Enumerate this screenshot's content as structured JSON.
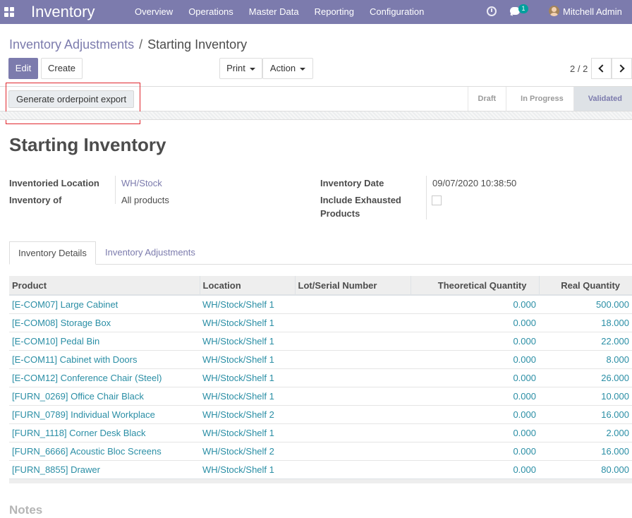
{
  "navbar": {
    "brand": "Inventory",
    "menu": [
      "Overview",
      "Operations",
      "Master Data",
      "Reporting",
      "Configuration"
    ],
    "chat_badge": "1",
    "user": "Mitchell Admin"
  },
  "breadcrumb": {
    "parent": "Inventory Adjustments",
    "separator": "/",
    "current": "Starting Inventory"
  },
  "buttons": {
    "edit": "Edit",
    "create": "Create",
    "print": "Print",
    "action": "Action"
  },
  "pager": {
    "value": "2 / 2"
  },
  "statusbar": {
    "export_button": "Generate orderpoint export",
    "stages": [
      "Draft",
      "In Progress",
      "Validated"
    ],
    "current_stage": "Validated"
  },
  "form": {
    "title": "Starting Inventory",
    "inventoried_location_label": "Inventoried Location",
    "inventoried_location_value": "WH/Stock",
    "inventory_of_label": "Inventory of",
    "inventory_of_value": "All products",
    "inventory_date_label": "Inventory Date",
    "inventory_date_value": "09/07/2020 10:38:50",
    "include_exhausted_label_1": "Include Exhausted",
    "include_exhausted_label_2": "Products",
    "include_exhausted_checked": false
  },
  "tabs": [
    "Inventory Details",
    "Inventory Adjustments"
  ],
  "table": {
    "columns": [
      "Product",
      "Location",
      "Lot/Serial Number",
      "Theoretical Quantity",
      "Real Quantity"
    ],
    "rows": [
      {
        "product": "[E-COM07] Large Cabinet",
        "location": "WH/Stock/Shelf 1",
        "lot": "",
        "theoretical": "0.000",
        "real": "500.000"
      },
      {
        "product": "[E-COM08] Storage Box",
        "location": "WH/Stock/Shelf 1",
        "lot": "",
        "theoretical": "0.000",
        "real": "18.000"
      },
      {
        "product": "[E-COM10] Pedal Bin",
        "location": "WH/Stock/Shelf 1",
        "lot": "",
        "theoretical": "0.000",
        "real": "22.000"
      },
      {
        "product": "[E-COM11] Cabinet with Doors",
        "location": "WH/Stock/Shelf 1",
        "lot": "",
        "theoretical": "0.000",
        "real": "8.000"
      },
      {
        "product": "[E-COM12] Conference Chair (Steel)",
        "location": "WH/Stock/Shelf 1",
        "lot": "",
        "theoretical": "0.000",
        "real": "26.000"
      },
      {
        "product": "[FURN_0269] Office Chair Black",
        "location": "WH/Stock/Shelf 1",
        "lot": "",
        "theoretical": "0.000",
        "real": "10.000"
      },
      {
        "product": "[FURN_0789] Individual Workplace",
        "location": "WH/Stock/Shelf 2",
        "lot": "",
        "theoretical": "0.000",
        "real": "16.000"
      },
      {
        "product": "[FURN_1118] Corner Desk Black",
        "location": "WH/Stock/Shelf 1",
        "lot": "",
        "theoretical": "0.000",
        "real": "2.000"
      },
      {
        "product": "[FURN_6666] Acoustic Bloc Screens",
        "location": "WH/Stock/Shelf 2",
        "lot": "",
        "theoretical": "0.000",
        "real": "16.000"
      },
      {
        "product": "[FURN_8855] Drawer",
        "location": "WH/Stock/Shelf 1",
        "lot": "",
        "theoretical": "0.000",
        "real": "80.000"
      }
    ]
  },
  "notes_label": "Notes"
}
